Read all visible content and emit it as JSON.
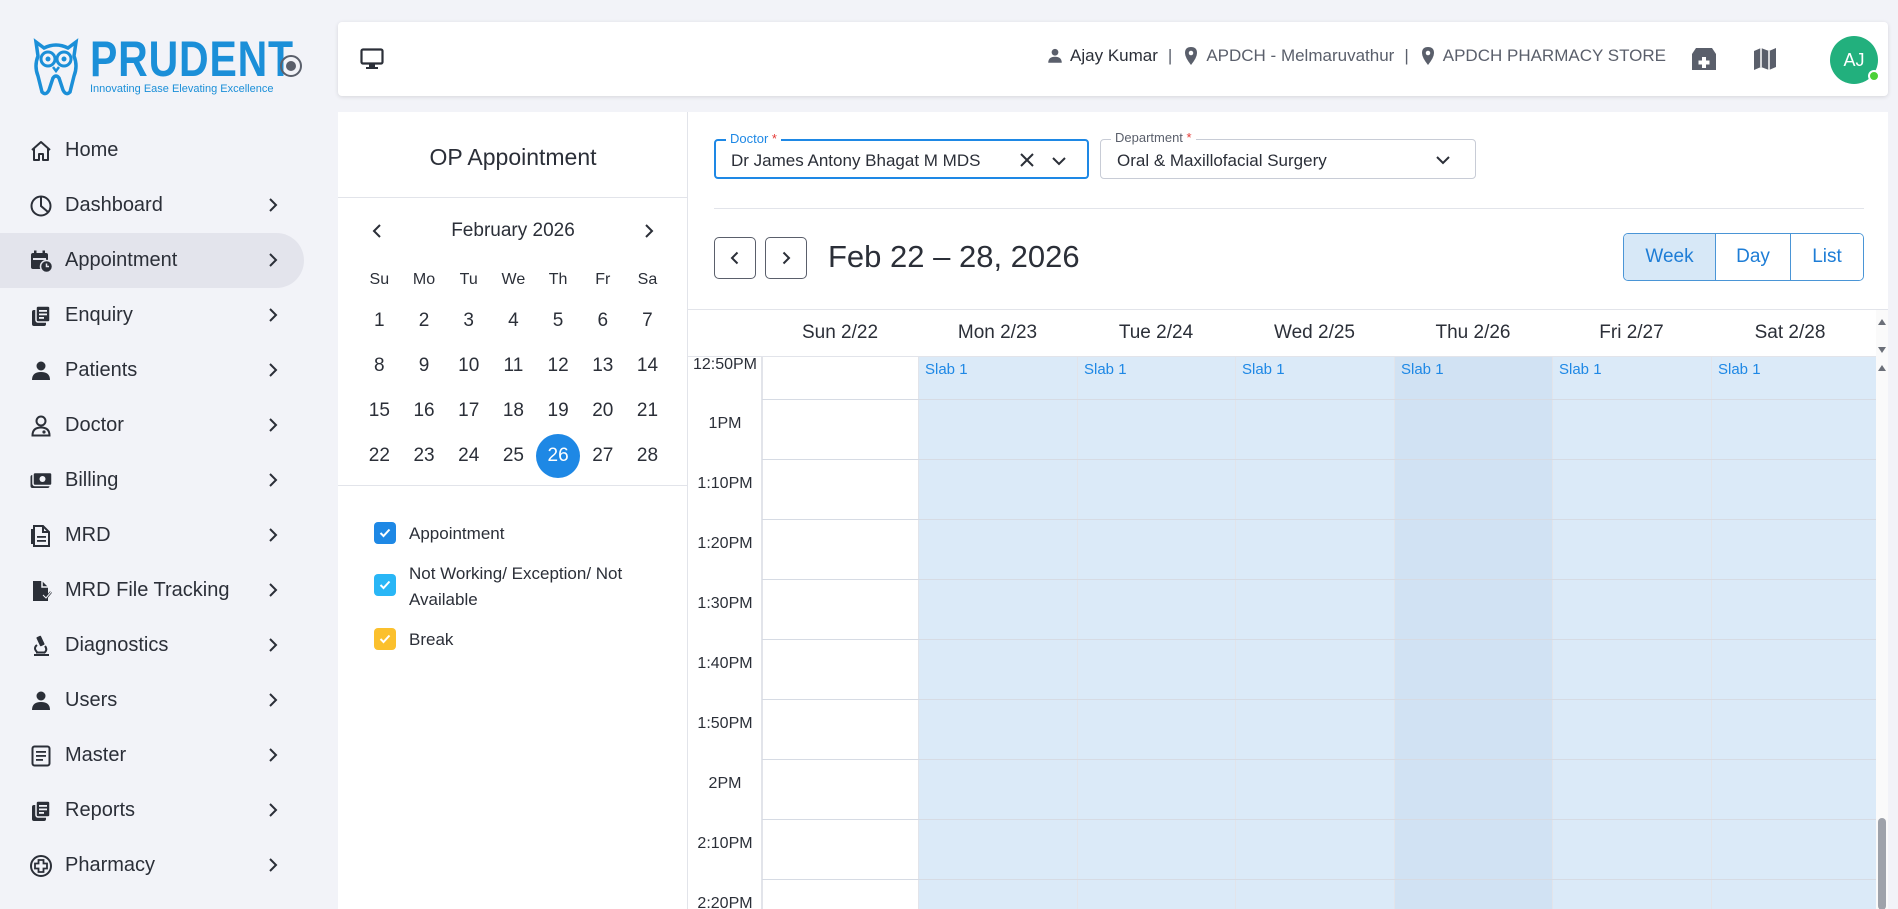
{
  "brand": {
    "name": "PRUDENT",
    "tagline": "Innovating Ease Elevating Excellence",
    "color": "#1b8fd8"
  },
  "sidebar": {
    "items": [
      {
        "label": "Home",
        "icon": "home-icon",
        "chevron": false
      },
      {
        "label": "Dashboard",
        "icon": "pie-chart-icon",
        "chevron": true
      },
      {
        "label": "Appointment",
        "icon": "calendar-clock-icon",
        "chevron": true,
        "active": true
      },
      {
        "label": "Enquiry",
        "icon": "document-stack-icon",
        "chevron": true
      },
      {
        "label": "Patients",
        "icon": "person-icon",
        "chevron": true
      },
      {
        "label": "Doctor",
        "icon": "doctor-icon",
        "chevron": true
      },
      {
        "label": "Billing",
        "icon": "money-icon",
        "chevron": true
      },
      {
        "label": "MRD",
        "icon": "file-icon",
        "chevron": true
      },
      {
        "label": "MRD File Tracking",
        "icon": "file-tracking-icon",
        "chevron": true
      },
      {
        "label": "Diagnostics",
        "icon": "microscope-icon",
        "chevron": true
      },
      {
        "label": "Users",
        "icon": "person-icon",
        "chevron": true
      },
      {
        "label": "Master",
        "icon": "list-box-icon",
        "chevron": true
      },
      {
        "label": "Reports",
        "icon": "document-stack-icon",
        "chevron": true
      },
      {
        "label": "Pharmacy",
        "icon": "medical-cross-icon",
        "chevron": true
      }
    ]
  },
  "topbar": {
    "user": "Ajay Kumar",
    "location": "APDCH - Melmaruvathur",
    "store": "APDCH PHARMACY STORE",
    "avatar_initials": "AJ"
  },
  "left_panel": {
    "title": "OP Appointment",
    "month": "February 2026",
    "weekdays": [
      "Su",
      "Mo",
      "Tu",
      "We",
      "Th",
      "Fr",
      "Sa"
    ],
    "weeks": [
      [
        "1",
        "2",
        "3",
        "4",
        "5",
        "6",
        "7"
      ],
      [
        "8",
        "9",
        "10",
        "11",
        "12",
        "13",
        "14"
      ],
      [
        "15",
        "16",
        "17",
        "18",
        "19",
        "20",
        "21"
      ],
      [
        "22",
        "23",
        "24",
        "25",
        "26",
        "27",
        "28"
      ]
    ],
    "selected_day": "26",
    "legend": [
      {
        "label": "Appointment",
        "color": "#1e88e5"
      },
      {
        "label": "Not Working/ Exception/ Not Available",
        "color": "#29b6f6"
      },
      {
        "label": "Break",
        "color": "#fbc02d"
      }
    ]
  },
  "filters": {
    "doctor": {
      "label": "Doctor",
      "required_mark": "*",
      "value": "Dr James Antony Bhagat M  MDS"
    },
    "department": {
      "label": "Department",
      "required_mark": "*",
      "value": "Oral & Maxillofacial Surgery"
    }
  },
  "calendar": {
    "range_title": "Feb 22 – 28, 2026",
    "views": [
      {
        "label": "Week",
        "active": true
      },
      {
        "label": "Day",
        "active": false
      },
      {
        "label": "List",
        "active": false
      }
    ],
    "days": [
      "Sun 2/22",
      "Mon 2/23",
      "Tue 2/24",
      "Wed 2/25",
      "Thu 2/26",
      "Fri 2/27",
      "Sat 2/28"
    ],
    "times": [
      "12:50PM",
      "1PM",
      "1:10PM",
      "1:20PM",
      "1:30PM",
      "1:40PM",
      "1:50PM",
      "2PM",
      "2:10PM",
      "2:20PM"
    ],
    "slab_label": "Slab 1",
    "slab_color": "#dbeaf8",
    "today_color": "#d1e2f3"
  }
}
